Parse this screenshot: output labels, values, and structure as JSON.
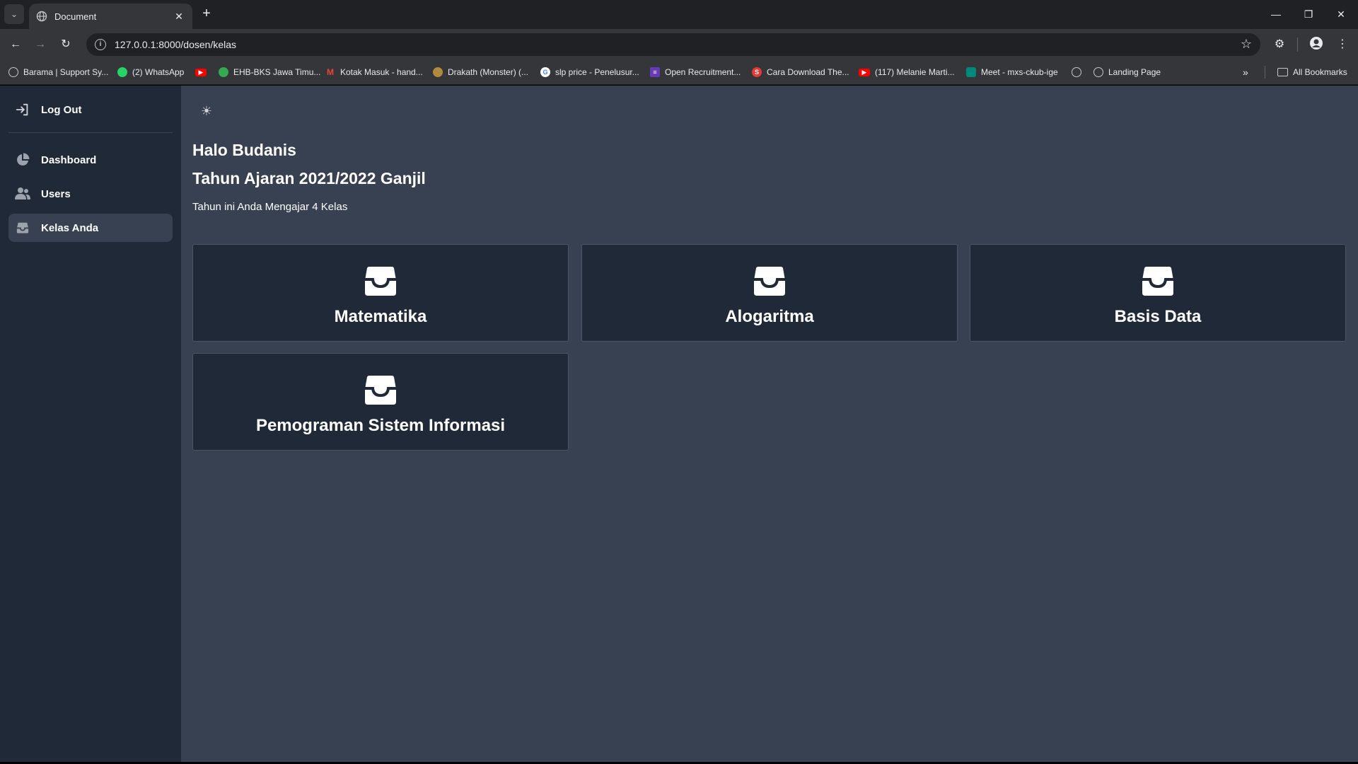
{
  "browser": {
    "tab_title": "Document",
    "url": "127.0.0.1:8000/dosen/kelas",
    "bookmarks": [
      {
        "label": "Barama | Support Sy...",
        "color": "#9aa0a6",
        "icon": "globe-icon"
      },
      {
        "label": "(2) WhatsApp",
        "color": "#25d366",
        "icon": "whatsapp-icon"
      },
      {
        "label": "",
        "color": "#ff0000",
        "icon": "youtube-icon"
      },
      {
        "label": "EHB-BKS Jawa Timu...",
        "color": "#34a853",
        "icon": "site-icon"
      },
      {
        "label": "Kotak Masuk - hand...",
        "color": "#ea4335",
        "icon": "gmail-icon"
      },
      {
        "label": "Drakath (Monster) (...",
        "color": "#b08a3e",
        "icon": "site-icon"
      },
      {
        "label": "slp price - Penelusur...",
        "color": "#ffffff",
        "icon": "google-icon"
      },
      {
        "label": "Open Recruitment...",
        "color": "#673ab7",
        "icon": "forms-icon"
      },
      {
        "label": "Cara Download The...",
        "color": "#e53935",
        "icon": "site-icon"
      },
      {
        "label": "(117) Melanie Marti...",
        "color": "#ff0000",
        "icon": "youtube-icon"
      },
      {
        "label": "Meet - mxs-ckub-ige",
        "color": "#00897b",
        "icon": "meet-icon"
      },
      {
        "label": "",
        "color": "#9aa0a6",
        "icon": "globe-icon"
      },
      {
        "label": "Landing Page",
        "color": "#9aa0a6",
        "icon": "globe-icon"
      }
    ],
    "all_bookmarks": "All Bookmarks"
  },
  "sidebar": {
    "logout": "Log Out",
    "items": [
      {
        "label": "Dashboard",
        "icon": "pie-chart-icon"
      },
      {
        "label": "Users",
        "icon": "users-icon"
      },
      {
        "label": "Kelas Anda",
        "icon": "inbox-icon",
        "active": true
      }
    ]
  },
  "main": {
    "greeting": "Halo Budanis",
    "academic_year": "Tahun Ajaran 2021/2022 Ganjil",
    "class_count_text": "Tahun ini Anda Mengajar 4 Kelas",
    "classes": [
      {
        "name": "Matematika",
        "icon": "inbox-tray-icon"
      },
      {
        "name": "Alogaritma",
        "icon": "inbox-tray-icon"
      },
      {
        "name": "Basis Data",
        "icon": "inbox-tray-icon"
      },
      {
        "name": "Pemograman Sistem Informasi",
        "icon": "inbox-tray-icon"
      }
    ]
  },
  "colors": {
    "page_bg": "#374151",
    "sidebar_bg": "#1f2937",
    "card_bg": "#1f2937"
  }
}
